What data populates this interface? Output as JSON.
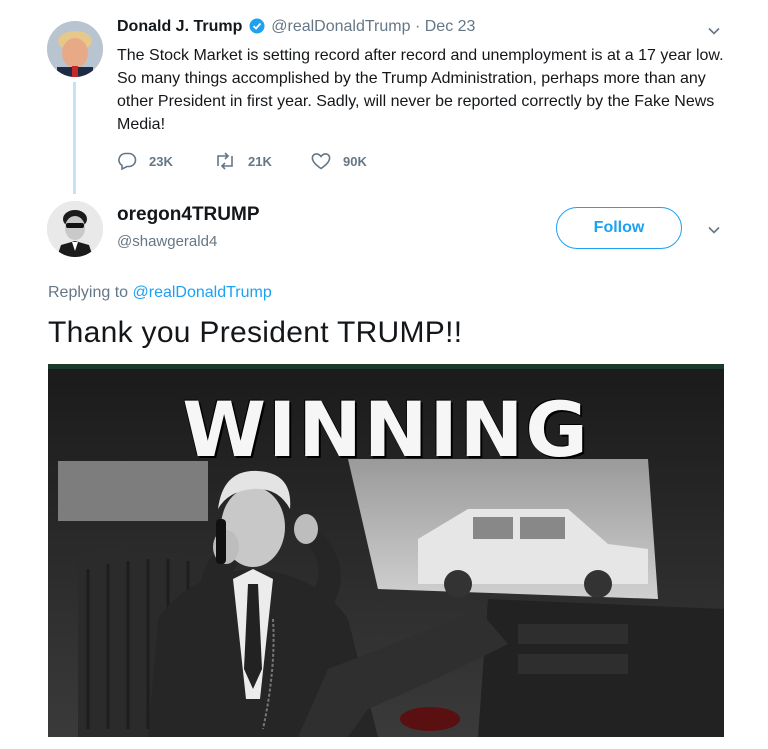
{
  "original_tweet": {
    "author_name": "Donald J. Trump",
    "author_handle": "@realDonaldTrump",
    "separator": "·",
    "date": "Dec 23",
    "text": "The Stock Market is setting record after record and unemployment is at a 17 year low. So many things accomplished by the Trump Administration, perhaps more than any other President in first year. Sadly, will never be reported correctly by the Fake News Media!",
    "replies": "23K",
    "retweets": "21K",
    "likes": "90K"
  },
  "reply_tweet": {
    "author_name": "oregon4TRUMP",
    "author_handle": "@shawgerald4",
    "follow_label": "Follow",
    "replying_prefix": "Replying to",
    "replying_to": "@realDonaldTrump",
    "text": "Thank you President TRUMP!!",
    "media_text": "WINNING"
  },
  "colors": {
    "accent": "#1da1f2",
    "muted": "#657786",
    "text": "#14171a",
    "thread_line": "#c4e4f5"
  },
  "icons": {
    "verified": "verified-badge-icon",
    "reply": "reply-icon",
    "retweet": "retweet-icon",
    "like": "heart-icon",
    "more": "chevron-down-icon"
  }
}
